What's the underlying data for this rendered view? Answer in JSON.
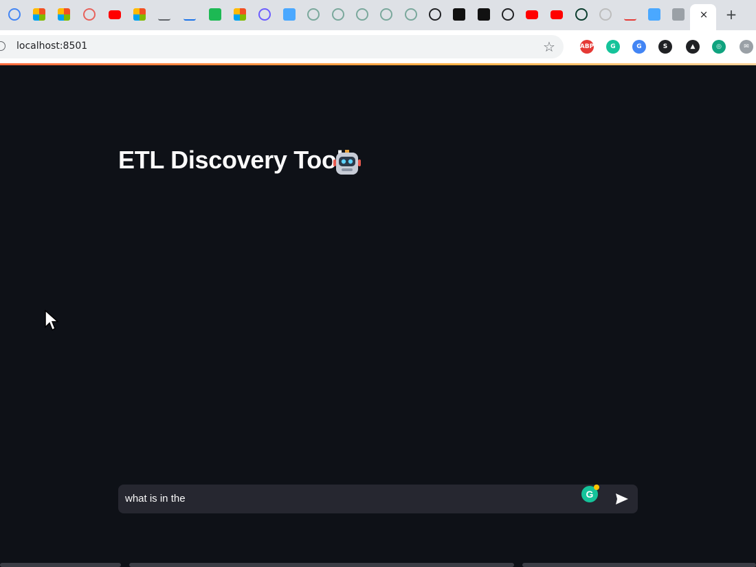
{
  "browser": {
    "url": "localhost:8501",
    "close_tab_glyph": "×",
    "new_tab_glyph": "+"
  },
  "tabs": [
    {
      "icon": "google-icon",
      "color": "#4285f4"
    },
    {
      "icon": "microsoft-icon",
      "color": "#f25022"
    },
    {
      "icon": "microsoft-icon",
      "color": "#f25022"
    },
    {
      "icon": "target-icon",
      "color": "#e8615a"
    },
    {
      "icon": "youtube-icon",
      "color": "#ff0000"
    },
    {
      "icon": "microsoft-icon",
      "color": "#f25022"
    },
    {
      "icon": "code-icon",
      "color": "#5f6368"
    },
    {
      "icon": "n8n-icon",
      "color": "#1a73e8"
    },
    {
      "icon": "green-app-icon",
      "color": "#1db954"
    },
    {
      "icon": "microsoft-icon",
      "color": "#f25022"
    },
    {
      "icon": "gear-icon",
      "color": "#6b5cff"
    },
    {
      "icon": "blue-doc-icon",
      "color": "#4aa8ff"
    },
    {
      "icon": "globe-icon",
      "color": "#7aa89c"
    },
    {
      "icon": "globe-icon",
      "color": "#7aa89c"
    },
    {
      "icon": "globe-icon",
      "color": "#7aa89c"
    },
    {
      "icon": "globe-icon",
      "color": "#7aa89c"
    },
    {
      "icon": "globe-icon",
      "color": "#7aa89c"
    },
    {
      "icon": "openai-icon",
      "color": "#202124"
    },
    {
      "icon": "terminal-icon",
      "color": "#111111"
    },
    {
      "icon": "terminal-icon",
      "color": "#111111"
    },
    {
      "icon": "openai-icon",
      "color": "#202124"
    },
    {
      "icon": "youtube-icon",
      "color": "#ff0000"
    },
    {
      "icon": "youtube-icon",
      "color": "#ff0000"
    },
    {
      "icon": "circle-app-icon",
      "color": "#0b3d2e"
    },
    {
      "icon": "github-icon",
      "color": "#bdbdbd"
    },
    {
      "icon": "pencil-icon",
      "color": "#e53935"
    },
    {
      "icon": "blue-doc-icon",
      "color": "#4aa8ff"
    },
    {
      "icon": "notebook-icon",
      "color": "#9aa0a6"
    }
  ],
  "extensions": [
    {
      "icon": "adblock-icon",
      "label": "ABP",
      "color": "#e53935"
    },
    {
      "icon": "grammarly-ext-icon",
      "label": "G",
      "color": "#15c39a"
    },
    {
      "icon": "translate-icon",
      "label": "G",
      "color": "#4285f4"
    },
    {
      "icon": "s-ext-icon",
      "label": "S",
      "color": "#202124"
    },
    {
      "icon": "triangle-ext-icon",
      "label": "▲",
      "color": "#202124"
    },
    {
      "icon": "green-ext-icon",
      "label": "◎",
      "color": "#10a37f"
    },
    {
      "icon": "mail-ext-icon",
      "label": "✉",
      "color": "#9aa0a6"
    }
  ],
  "app": {
    "title": "ETL Discovery Tool",
    "chat_input_value": "what is in the",
    "grammarly_letter": "G"
  },
  "colors": {
    "background": "#0e1117",
    "input_background": "#262730",
    "text": "#fafafa"
  }
}
